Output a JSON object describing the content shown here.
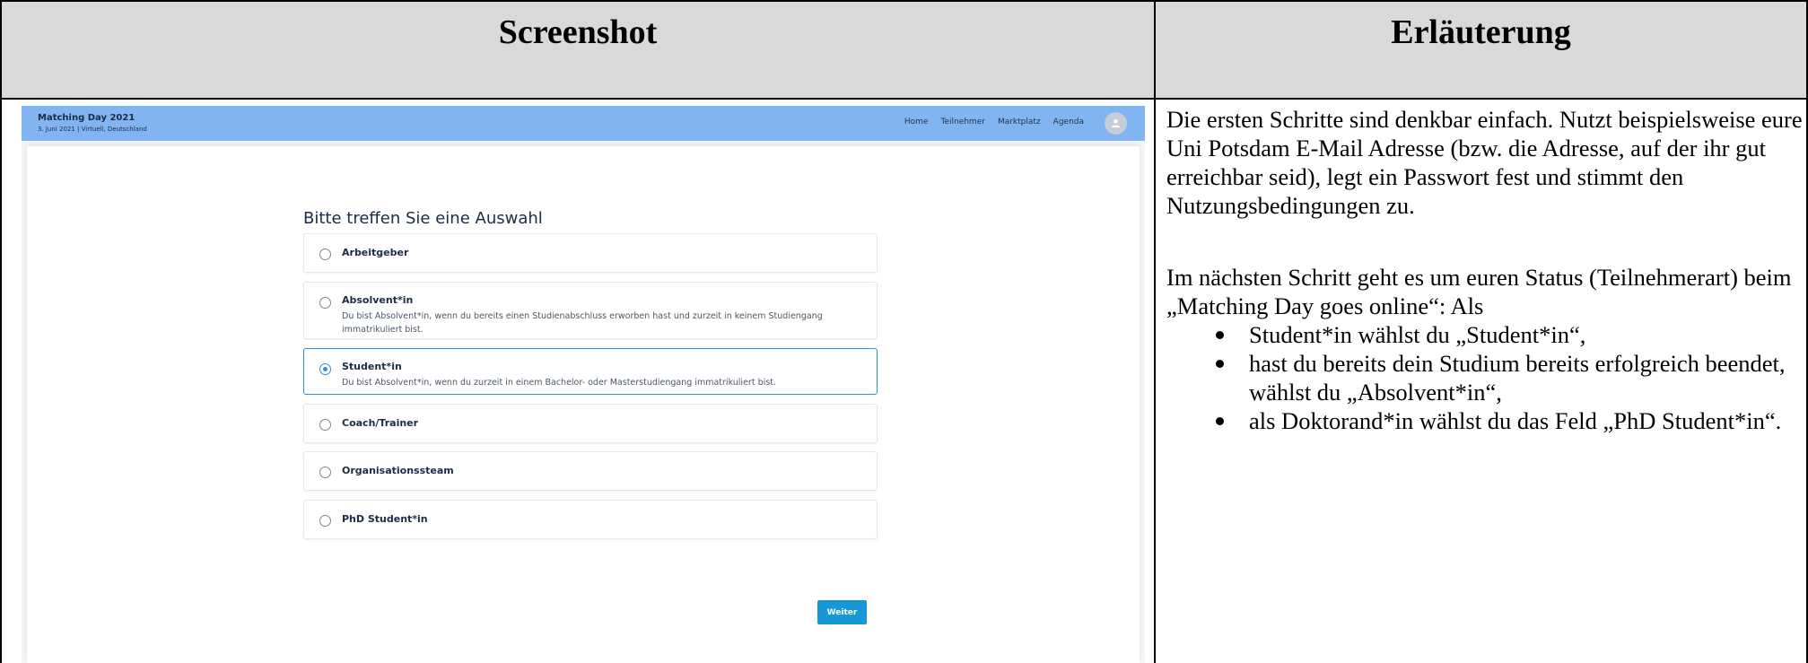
{
  "table": {
    "col1_title": "Screenshot",
    "col2_title": "Erläuterung"
  },
  "app": {
    "event_title": "Matching Day 2021",
    "event_subtitle": "3. Juni 2021 | Virtuell, Deutschland",
    "nav": [
      "Home",
      "Teilnehmer",
      "Marktplatz",
      "Agenda"
    ],
    "heading": "Bitte treffen Sie eine Auswahl",
    "options": [
      {
        "label": "Arbeitgeber",
        "desc": "",
        "selected": false
      },
      {
        "label": "Absolvent*in",
        "desc": "Du bist Absolvent*in, wenn du bereits einen Studienabschluss erworben hast und zurzeit in keinem Studiengang immatrikuliert bist.",
        "selected": false
      },
      {
        "label": "Student*in",
        "desc": "Du bist Absolvent*in, wenn du zurzeit in einem Bachelor- oder Masterstudiengang immatrikuliert bist.",
        "selected": true
      },
      {
        "label": "Coach/Trainer",
        "desc": "",
        "selected": false
      },
      {
        "label": "Organisationssteam",
        "desc": "",
        "selected": false
      },
      {
        "label": "PhD Student*in",
        "desc": "",
        "selected": false
      }
    ],
    "next_label": "Weiter",
    "colors": {
      "topbar": "#82b4f2",
      "accent": "#1698d8",
      "selected_border": "#2e8fd6"
    }
  },
  "explanation": {
    "para1": "Die ersten Schritte sind denkbar einfach. Nutzt beispielsweise eure Uni Potsdam E-Mail Adresse (bzw. die Adresse, auf der ihr gut erreichbar seid), legt ein Passwort fest und stimmt den Nutzungsbedingungen zu.",
    "para2": "Im nächsten Schritt geht es um euren Status (Teilnehmerart) beim „Matching Day goes online“: Als",
    "bullets": [
      "Student*in wählst du „Student*in“,",
      "hast du bereits dein Studium bereits erfolgreich beendet, wählst du „Absolvent*in“,",
      "als Doktorand*in wählst du das Feld „PhD Student*in“."
    ]
  }
}
